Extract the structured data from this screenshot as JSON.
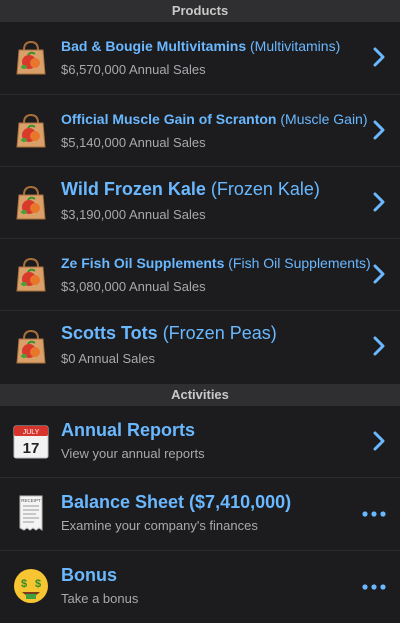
{
  "products_header": "Products",
  "activities_header": "Activities",
  "products": [
    {
      "name": "Bad & Bougie Multivitamins",
      "category": "(Multivitamins)",
      "sales": "$6,570,000 Annual Sales",
      "big": false
    },
    {
      "name": "Official Muscle Gain of Scranton",
      "category": "(Muscle Gain)",
      "sales": "$5,140,000 Annual Sales",
      "big": false
    },
    {
      "name": "Wild Frozen Kale",
      "category": "(Frozen Kale)",
      "sales": "$3,190,000 Annual Sales",
      "big": true
    },
    {
      "name": "Ze Fish Oil Supplements",
      "category": "(Fish Oil Supplements)",
      "sales": "$3,080,000 Annual Sales",
      "big": false
    },
    {
      "name": "Scotts Tots",
      "category": "(Frozen Peas)",
      "sales": "$0 Annual Sales",
      "big": true
    }
  ],
  "activities": [
    {
      "title": "Annual Reports",
      "subtitle": "View your annual reports",
      "icon": "calendar-icon",
      "calendar_month": "JULY",
      "calendar_day": "17",
      "action": "chevron"
    },
    {
      "title": "Balance Sheet ($7,410,000)",
      "subtitle": "Examine your company's finances",
      "icon": "receipt-icon",
      "receipt_label": "RECEIPT",
      "action": "more"
    },
    {
      "title": "Bonus",
      "subtitle": "Take a bonus",
      "icon": "money-face-icon",
      "action": "more"
    }
  ],
  "colors": {
    "background": "#1c1c1e",
    "link_blue": "#6ab8ff",
    "subtext": "#a9a9ad",
    "section_header_bg": "#2f2f31",
    "top_bar": "#11365a"
  }
}
